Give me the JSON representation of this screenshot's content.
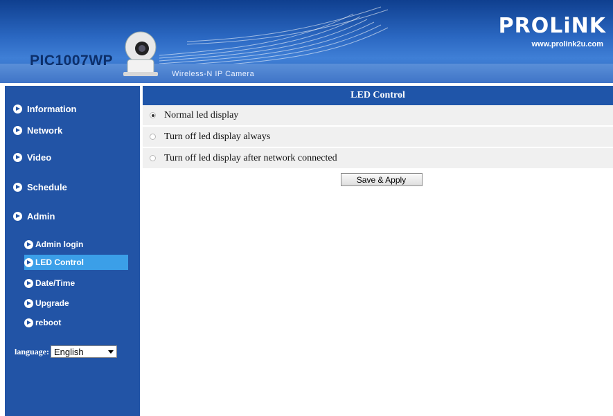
{
  "header": {
    "model": "PIC1007WP",
    "tagline": "Wireless-N IP Camera",
    "brand": "PROLiNK",
    "url": "www.prolink2u.com"
  },
  "sidebar": {
    "items": [
      {
        "label": "Information",
        "icon": "arrow-circle-icon"
      },
      {
        "label": "Network",
        "icon": "arrow-circle-icon"
      },
      {
        "label": "Video",
        "icon": "arrow-circle-icon"
      },
      {
        "label": "Schedule",
        "icon": "arrow-circle-icon"
      },
      {
        "label": "Admin",
        "icon": "arrow-circle-icon"
      }
    ],
    "subitems": [
      {
        "label": "Admin login",
        "active": false
      },
      {
        "label": "LED Control",
        "active": true
      },
      {
        "label": "Date/Time",
        "active": false
      },
      {
        "label": "Upgrade",
        "active": false
      },
      {
        "label": "reboot",
        "active": false
      }
    ],
    "language": {
      "label": "language:",
      "selected": "English"
    }
  },
  "main": {
    "title": "LED Control",
    "options": [
      {
        "label": "Normal led display",
        "checked": true
      },
      {
        "label": "Turn off led display always",
        "checked": false
      },
      {
        "label": "Turn off led display after network connected",
        "checked": false
      }
    ],
    "apply_label": "Save & Apply"
  },
  "colors": {
    "sidebar_bg": "#2254a6",
    "title_bar": "#1f55a9",
    "active_item": "#3b9fe8"
  }
}
